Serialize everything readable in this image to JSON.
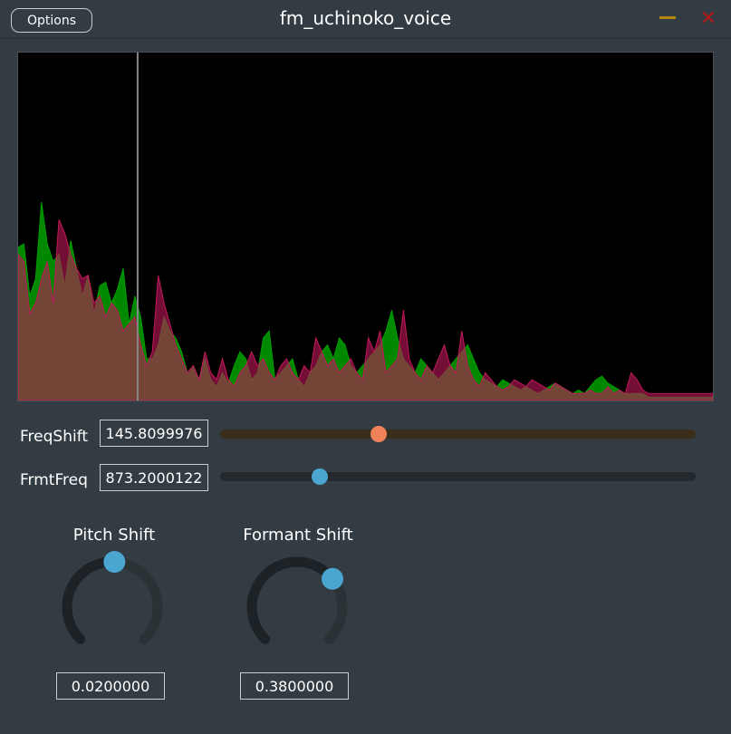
{
  "window": {
    "title": "fm_uchinoko_voice",
    "options_label": "Options",
    "minimize_icon": "minimize-icon",
    "close_icon": "close-icon",
    "close_glyph": "✕",
    "accent_colors": {
      "minimize": "#b8860b",
      "close": "#b11a1a"
    }
  },
  "spectrum": {
    "green_color": "#00a000",
    "red_color": "#c2185b",
    "marker_color": "#888888",
    "marker_position": 0.172,
    "green_levels": [
      0.44,
      0.45,
      0.3,
      0.35,
      0.57,
      0.45,
      0.4,
      0.42,
      0.33,
      0.46,
      0.38,
      0.3,
      0.36,
      0.25,
      0.33,
      0.34,
      0.28,
      0.32,
      0.38,
      0.22,
      0.3,
      0.24,
      0.12,
      0.12,
      0.16,
      0.24,
      0.2,
      0.18,
      0.14,
      0.08,
      0.1,
      0.06,
      0.12,
      0.06,
      0.04,
      0.08,
      0.05,
      0.1,
      0.14,
      0.12,
      0.06,
      0.08,
      0.18,
      0.2,
      0.06,
      0.08,
      0.1,
      0.12,
      0.06,
      0.04,
      0.08,
      0.1,
      0.14,
      0.16,
      0.12,
      0.18,
      0.16,
      0.1,
      0.08,
      0.1,
      0.12,
      0.14,
      0.16,
      0.2,
      0.26,
      0.18,
      0.12,
      0.1,
      0.08,
      0.12,
      0.1,
      0.08,
      0.06,
      0.08,
      0.1,
      0.12,
      0.14,
      0.16,
      0.12,
      0.08,
      0.06,
      0.05,
      0.04,
      0.06,
      0.05,
      0.04,
      0.03,
      0.04,
      0.03,
      0.02,
      0.03,
      0.04,
      0.05,
      0.04,
      0.03,
      0.02,
      0.03,
      0.02,
      0.04,
      0.06,
      0.07,
      0.05,
      0.04,
      0.03,
      0.02,
      0.02,
      0.02,
      0.02,
      0.01,
      0.01,
      0.01,
      0.01,
      0.01,
      0.01,
      0.01,
      0.01,
      0.01,
      0.01,
      0.01,
      0.01
    ],
    "red_levels": [
      0.42,
      0.4,
      0.25,
      0.28,
      0.35,
      0.4,
      0.28,
      0.52,
      0.48,
      0.42,
      0.38,
      0.35,
      0.36,
      0.28,
      0.3,
      0.24,
      0.28,
      0.26,
      0.2,
      0.22,
      0.24,
      0.16,
      0.1,
      0.14,
      0.36,
      0.28,
      0.22,
      0.16,
      0.12,
      0.08,
      0.1,
      0.06,
      0.14,
      0.08,
      0.06,
      0.12,
      0.06,
      0.04,
      0.08,
      0.1,
      0.14,
      0.1,
      0.12,
      0.08,
      0.06,
      0.1,
      0.12,
      0.08,
      0.06,
      0.1,
      0.08,
      0.18,
      0.14,
      0.1,
      0.12,
      0.08,
      0.1,
      0.12,
      0.08,
      0.06,
      0.18,
      0.14,
      0.2,
      0.08,
      0.1,
      0.12,
      0.26,
      0.12,
      0.08,
      0.06,
      0.1,
      0.08,
      0.12,
      0.16,
      0.1,
      0.08,
      0.2,
      0.1,
      0.06,
      0.04,
      0.08,
      0.06,
      0.04,
      0.03,
      0.04,
      0.06,
      0.05,
      0.04,
      0.06,
      0.05,
      0.04,
      0.03,
      0.05,
      0.04,
      0.03,
      0.02,
      0.02,
      0.02,
      0.03,
      0.02,
      0.02,
      0.04,
      0.02,
      0.03,
      0.02,
      0.08,
      0.06,
      0.03,
      0.02,
      0.02,
      0.02,
      0.02,
      0.02,
      0.02,
      0.02,
      0.02,
      0.02,
      0.02,
      0.02,
      0.02
    ]
  },
  "freq_shift": {
    "label": "FreqShift",
    "value": "145.8099976",
    "position": 0.333,
    "track_color": "#3a2e1a",
    "thumb_color": "#f0825a"
  },
  "frmt_freq": {
    "label": "FrmtFreq",
    "value": "873.2000122",
    "position": 0.21,
    "track_color": "#23292d",
    "thumb_color": "#4aa6d0"
  },
  "pitch_shift": {
    "label": "Pitch Shift",
    "value": "0.0200000",
    "normalized": 0.51
  },
  "formant_shift": {
    "label": "Formant Shift",
    "value": "0.3800000",
    "normalized": 0.69
  }
}
